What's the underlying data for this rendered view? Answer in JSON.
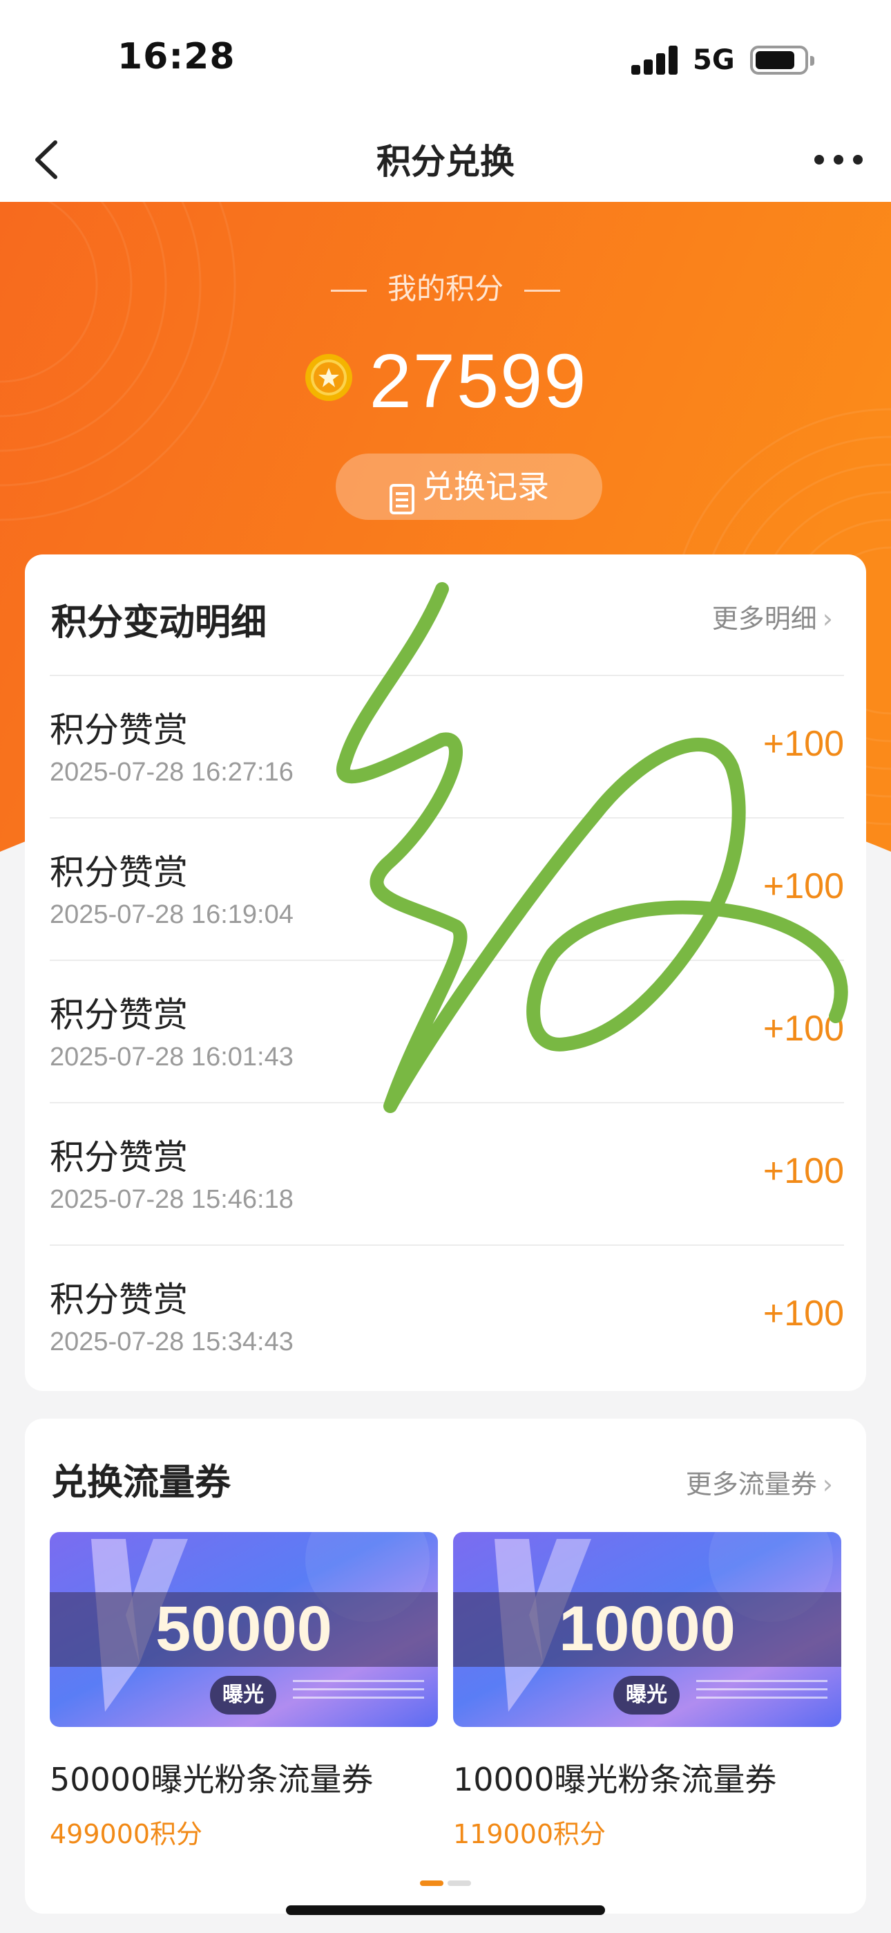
{
  "status_bar": {
    "time": "16:28",
    "network": "5G"
  },
  "nav": {
    "title": "积分兑换"
  },
  "hero": {
    "label": "我的积分",
    "points": "27599",
    "records_button": "兑换记录"
  },
  "points_detail": {
    "title": "积分变动明细",
    "more": "更多明细",
    "items": [
      {
        "title": "积分赞赏",
        "time": "2025-07-28 16:27:16",
        "amount": "+100"
      },
      {
        "title": "积分赞赏",
        "time": "2025-07-28 16:19:04",
        "amount": "+100"
      },
      {
        "title": "积分赞赏",
        "time": "2025-07-28 16:01:43",
        "amount": "+100"
      },
      {
        "title": "积分赞赏",
        "time": "2025-07-28 15:46:18",
        "amount": "+100"
      },
      {
        "title": "积分赞赏",
        "time": "2025-07-28 15:34:43",
        "amount": "+100"
      }
    ]
  },
  "coupons": {
    "title": "兑换流量券",
    "more": "更多流量券",
    "items": [
      {
        "number": "50000",
        "tag": "曝光",
        "name": "50000曝光粉条流量券",
        "price": "499000积分"
      },
      {
        "number": "10000",
        "tag": "曝光",
        "name": "10000曝光粉条流量券",
        "price": "119000积分"
      }
    ]
  },
  "icons": {
    "back": "chevron-left-icon",
    "more": "more-dots-icon",
    "coin": "coin-star-icon",
    "records": "document-icon"
  },
  "colors": {
    "hero_orange": "#f7741f",
    "accent_orange": "#f28a17",
    "scribble_green": "#79b843"
  }
}
